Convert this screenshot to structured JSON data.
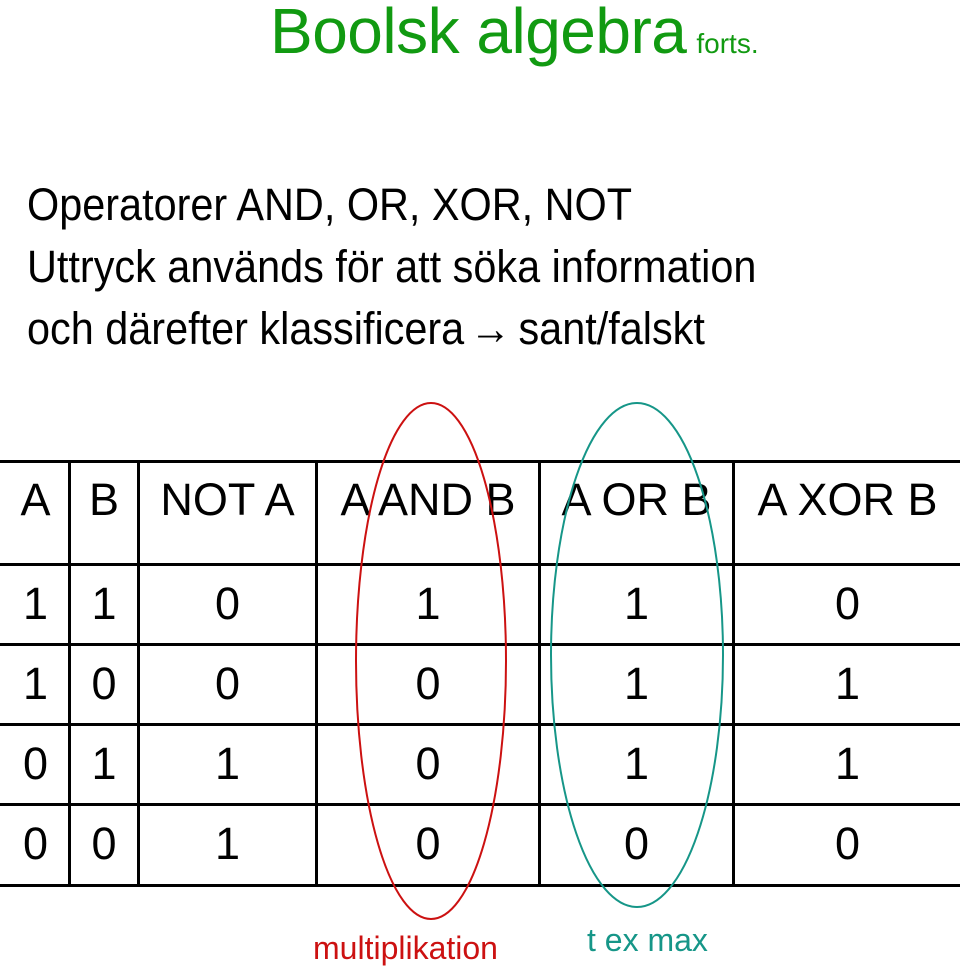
{
  "title": {
    "main": "Boolsk algebra",
    "suffix": "forts.",
    "color": "#119a11"
  },
  "bullets": [
    {
      "text": "Operatorer AND, OR, XOR, NOT"
    },
    {
      "text": "Uttryck används för att söka information"
    },
    {
      "pre": "och därefter klassificera",
      "arrow": "→",
      "post": "sant/falskt"
    }
  ],
  "table": {
    "headers": [
      "A",
      "B",
      "NOT A",
      "A AND B",
      "A OR B",
      "A XOR B"
    ],
    "rows": [
      [
        "1",
        "1",
        "0",
        "1",
        "1",
        "0"
      ],
      [
        "1",
        "0",
        "0",
        "0",
        "1",
        "1"
      ],
      [
        "0",
        "1",
        "1",
        "0",
        "1",
        "1"
      ],
      [
        "0",
        "0",
        "1",
        "0",
        "0",
        "0"
      ]
    ]
  },
  "annotations": {
    "and_note": {
      "text": "multiplikation",
      "color": "#cc1111"
    },
    "or_note": {
      "text": "t ex max",
      "color": "#169688"
    }
  }
}
